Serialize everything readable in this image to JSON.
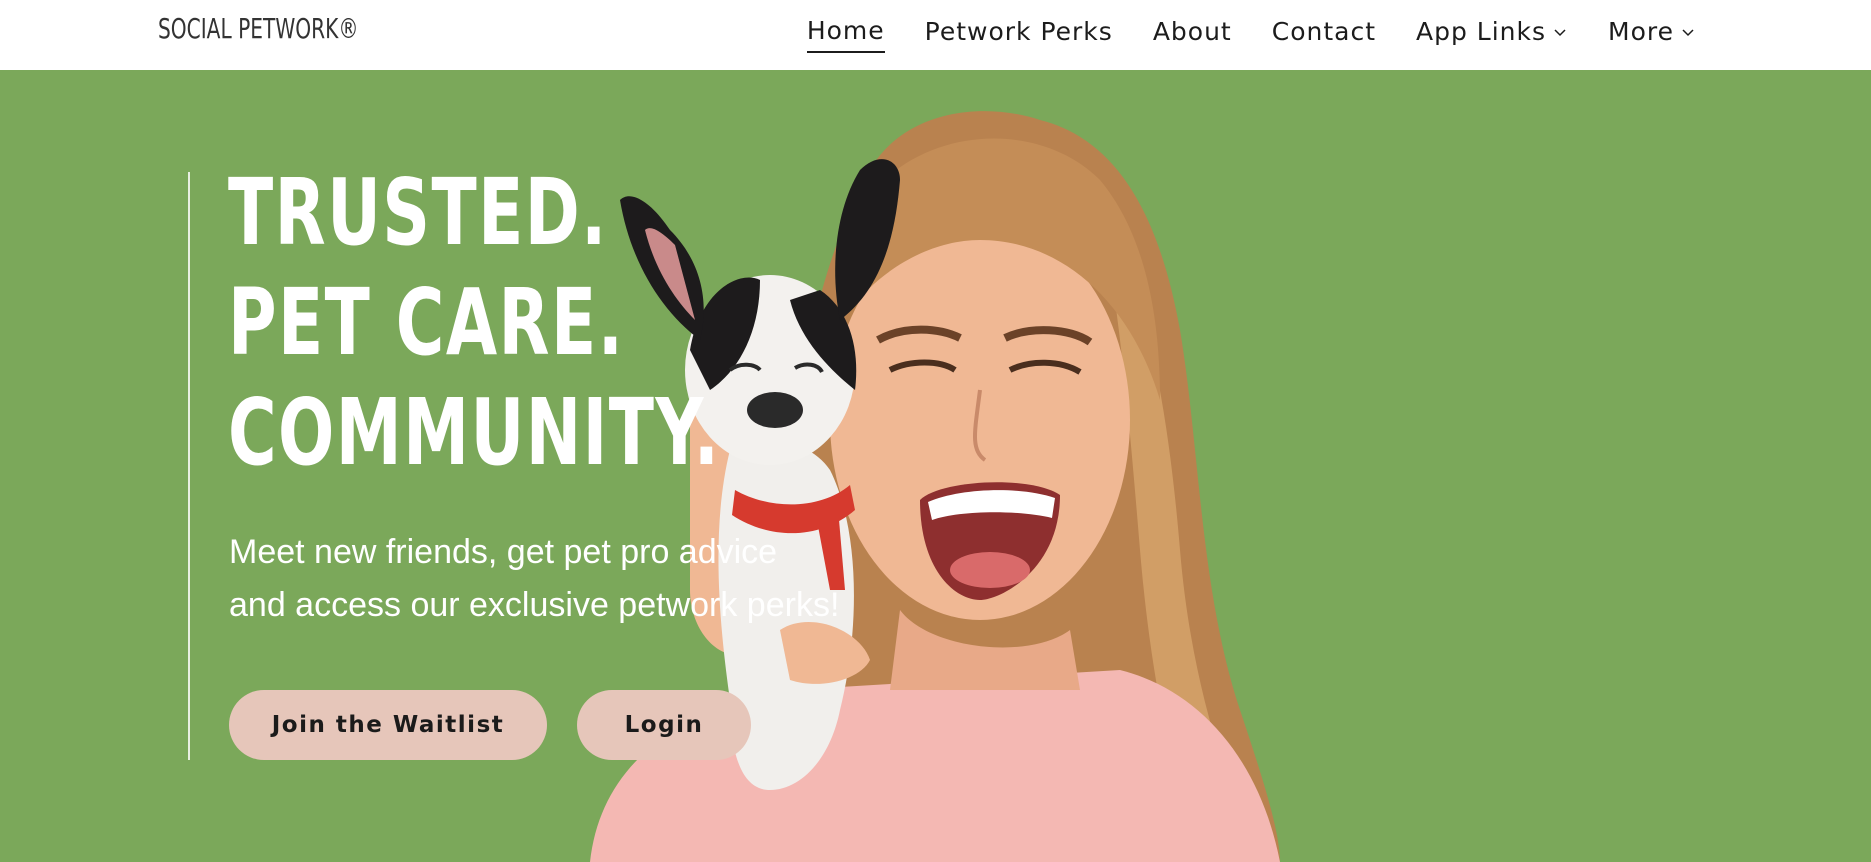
{
  "header": {
    "logo": "SOCIAL PETWORK®",
    "nav": [
      {
        "label": "Home",
        "active": true,
        "dropdown": false
      },
      {
        "label": "Petwork Perks",
        "active": false,
        "dropdown": false
      },
      {
        "label": "About",
        "active": false,
        "dropdown": false
      },
      {
        "label": "Contact",
        "active": false,
        "dropdown": false
      },
      {
        "label": "App Links",
        "active": false,
        "dropdown": true
      },
      {
        "label": "More",
        "active": false,
        "dropdown": true
      }
    ]
  },
  "hero": {
    "headline": [
      "TRUSTED.",
      "PET CARE.",
      "COMMUNITY."
    ],
    "subtext": [
      "Meet new friends, get pet pro advice",
      "and access our exclusive petwork perks!"
    ],
    "buttons": {
      "waitlist": "Join the Waitlist",
      "login": "Login"
    },
    "background_color": "#7ba85a",
    "button_color": "#e6c6ba"
  }
}
